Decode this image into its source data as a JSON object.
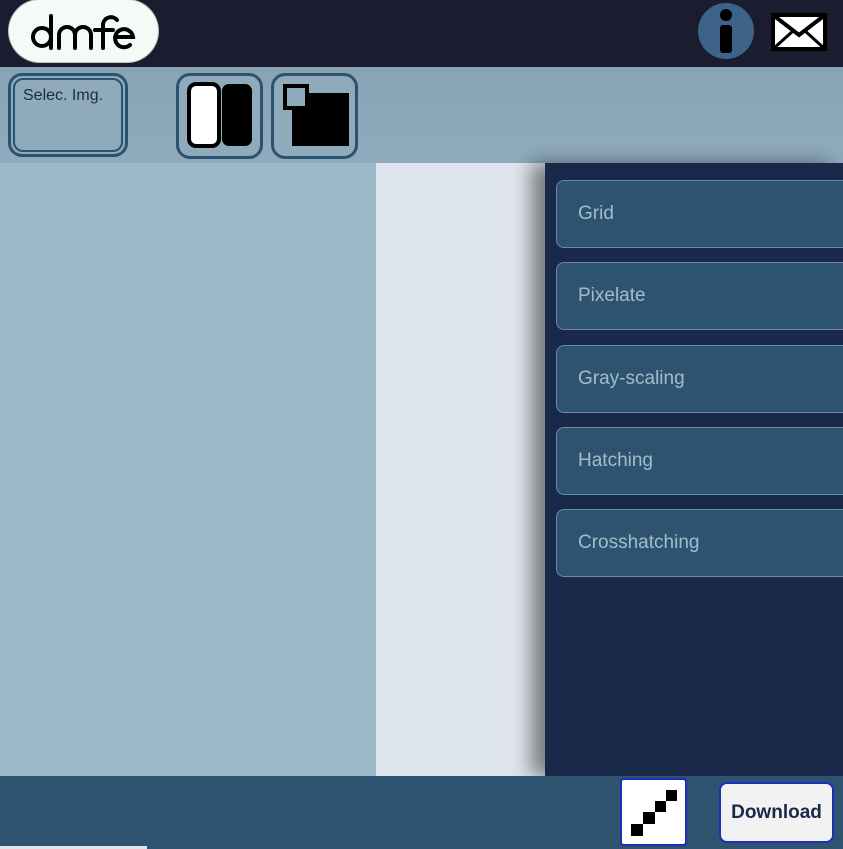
{
  "header": {
    "logo_text": "dmfe",
    "info_icon": "info-icon",
    "mail_icon": "mail-icon"
  },
  "toolbar": {
    "select_label": "Selec. Img.",
    "split_view_icon": "split-view-icon",
    "overlay_icon": "overlay-icon"
  },
  "filters": [
    {
      "label": "Grid"
    },
    {
      "label": "Pixelate"
    },
    {
      "label": "Gray-scaling"
    },
    {
      "label": "Hatching"
    },
    {
      "label": "Crosshatching"
    }
  ],
  "footer": {
    "pixel_icon": "pixel-diagonal-icon",
    "download_label": "Download"
  },
  "colors": {
    "header_bg": "#1b1c30",
    "toolbar_bg": "#8fabbd",
    "panel_bg": "#18294a",
    "filter_item_bg": "#2d5370",
    "footer_bg": "#2d5370",
    "accent_border": "#1d2fb8"
  }
}
